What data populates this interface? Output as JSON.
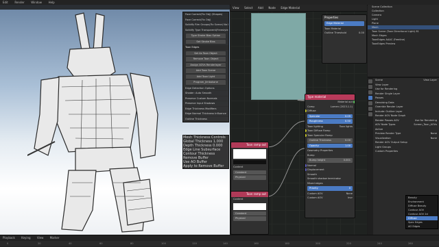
{
  "topbar": {
    "menus": [
      "Edit",
      "Render",
      "Window",
      "Help"
    ],
    "workspace_tabs": [
      "Object",
      "View",
      "Add",
      "Node"
    ]
  },
  "viewport": {
    "overlay_rows": [
      "Face Correct(Fix Obj) (Shapes)",
      "Face Correct(Fix Obj)",
      "Solidify Rim Groups(Fix Scene) No Lat",
      "Solidify Type Transparent(Freestyle Fix Ver)",
      "Type Stroke Bias Option",
      "Set Stroke Bias"
    ],
    "overlay_section": "Toon Edges",
    "overlay_buttons": [
      "Set As Toon Object",
      "Remove Toon Object",
      "Assign AOVs Renderlayer",
      "Add Toon Scene",
      "Add Toon Light"
    ],
    "overlay_field": "Program_Jimbokane",
    "overlay_rows2": [
      "Edge Detection Options",
      "Shader: Auto Smooth",
      "Preserve Custom Normals",
      "Preserve Input Shadows",
      "Edge Thickness Modifiers",
      "Edge Normal Thickness Influence",
      "Outline Thickness"
    ],
    "overlay2_section": "Mesh Thickness Controls",
    "overlay2_rows": [
      "Global Thickness",
      "Depth Thickness",
      "Edge Line Subsurface",
      "Contour Thickness",
      "Remove Buffer",
      "Use AO Buffer",
      "Apply to Remove Buffer"
    ],
    "overlay2_rows_vals": [
      "1.000",
      "0.000",
      "",
      "",
      "",
      "",
      ""
    ]
  },
  "node_editor": {
    "header_items": [
      "View",
      "Select",
      "Add",
      "Node",
      "Edge Material"
    ],
    "properties_node": {
      "title": "Properties",
      "rows": [
        "Edge Material",
        "Toon Material",
        "Outline Threshold"
      ],
      "vals": [
        "",
        "",
        "0.00"
      ]
    },
    "type_material": {
      "title": "Type material",
      "output": "Material out",
      "rows": [
        {
          "label": "Comp",
          "value": "Lumen (2023.1.1)"
        },
        {
          "label": "Diffuse",
          "value": ""
        },
        {
          "label": "Specular",
          "value": "0.09"
        },
        {
          "label": "Roughness",
          "value": "0.50"
        },
        {
          "label": "Toon lighting",
          "value": "Toon lights"
        },
        {
          "label": "Toon Diffuse Ramp",
          "value": ""
        },
        {
          "label": "Toon Specular Ramp",
          "value": ""
        },
        {
          "label": "Outline Thickness",
          "value": "0.00"
        },
        {
          "label": "Opacity",
          "value": "1.00"
        },
        {
          "label": "Geometry Properties",
          "value": ""
        },
        {
          "label": "Bump",
          "value": ""
        },
        {
          "label": "Bump height",
          "value": "0.001"
        },
        {
          "label": "Normal",
          "value": ""
        },
        {
          "label": "Displacement",
          "value": ""
        },
        {
          "label": "Smooth",
          "value": ""
        },
        {
          "label": "Smooth shadow terminator",
          "value": ""
        },
        {
          "label": "Mixed edges",
          "value": ""
        },
        {
          "label": "Priority",
          "value": "0"
        },
        {
          "label": "Custom AOV",
          "value": "None"
        },
        {
          "label": "Custom AOV",
          "value": "Invr"
        }
      ]
    },
    "toon_ramp_1": {
      "title": "Toon ramp out",
      "rows": [
        "Constant",
        "Physical"
      ],
      "content_label": "Content"
    },
    "toon_ramp_2": {
      "title": "Toon ramp out",
      "rows": [
        "Constant",
        "Physical"
      ],
      "content_label": "Content"
    }
  },
  "properties_panel": {
    "outliner": [
      "Scene Collection",
      "Collection",
      "Camera",
      "Light",
      "Plane",
      "Mech",
      "Toon Scene (Toon Directional Light) 81",
      "Mech Edges",
      "ToonEdges AAAC (Freeline)",
      "ToonEdges Preview"
    ],
    "outliner_selected_index": 5,
    "rows": [
      {
        "label": "Scene",
        "value": "View Layer"
      },
      {
        "label": "View Layer",
        "value": ""
      },
      {
        "label": "Use for Rendering",
        "value": ""
      },
      {
        "label": "Render Single Layer",
        "value": ""
      },
      {
        "label": "Passes",
        "value": ""
      },
      {
        "label": "Denoising Data",
        "value": ""
      },
      {
        "label": "Override Render Layer",
        "value": ""
      },
      {
        "label": "Include: Outline Layer",
        "value": ""
      },
      {
        "label": "Render AOV Node Graph",
        "value": ""
      },
      {
        "label": "Render Passes AOV",
        "value": "Use for Rendering"
      },
      {
        "label": "AOV Node Types",
        "value": "Screen_Toon_AOVs"
      },
      {
        "label": "Active",
        "value": ""
      },
      {
        "label": "Preview Render Type",
        "value": "None"
      },
      {
        "label": "Visualization",
        "value": "None"
      },
      {
        "label": "Render AOV Output Setup",
        "value": ""
      },
      {
        "label": "Light Groups",
        "value": ""
      },
      {
        "label": "Custom Properties",
        "value": ""
      }
    ],
    "dropdown_options": [
      "Beauty",
      "Environment",
      "Diffuse Beauty",
      "Contour AOV",
      "Contour AOV 2d",
      "Diffuse",
      "Spec Edges",
      "AO Edges"
    ],
    "dropdown_highlight_index": 5
  },
  "timeline": {
    "controls": [
      "Playback",
      "Keying",
      "View",
      "Marker"
    ],
    "ticks": [
      "0",
      "20",
      "40",
      "60",
      "80",
      "100",
      "120",
      "140",
      "160",
      "180",
      "200",
      "220",
      "240",
      "260"
    ]
  },
  "colors": {
    "node_header_red": "#b83a5a",
    "teal_frame": "#7fa9a6",
    "selection_blue": "#4b7bc4"
  }
}
